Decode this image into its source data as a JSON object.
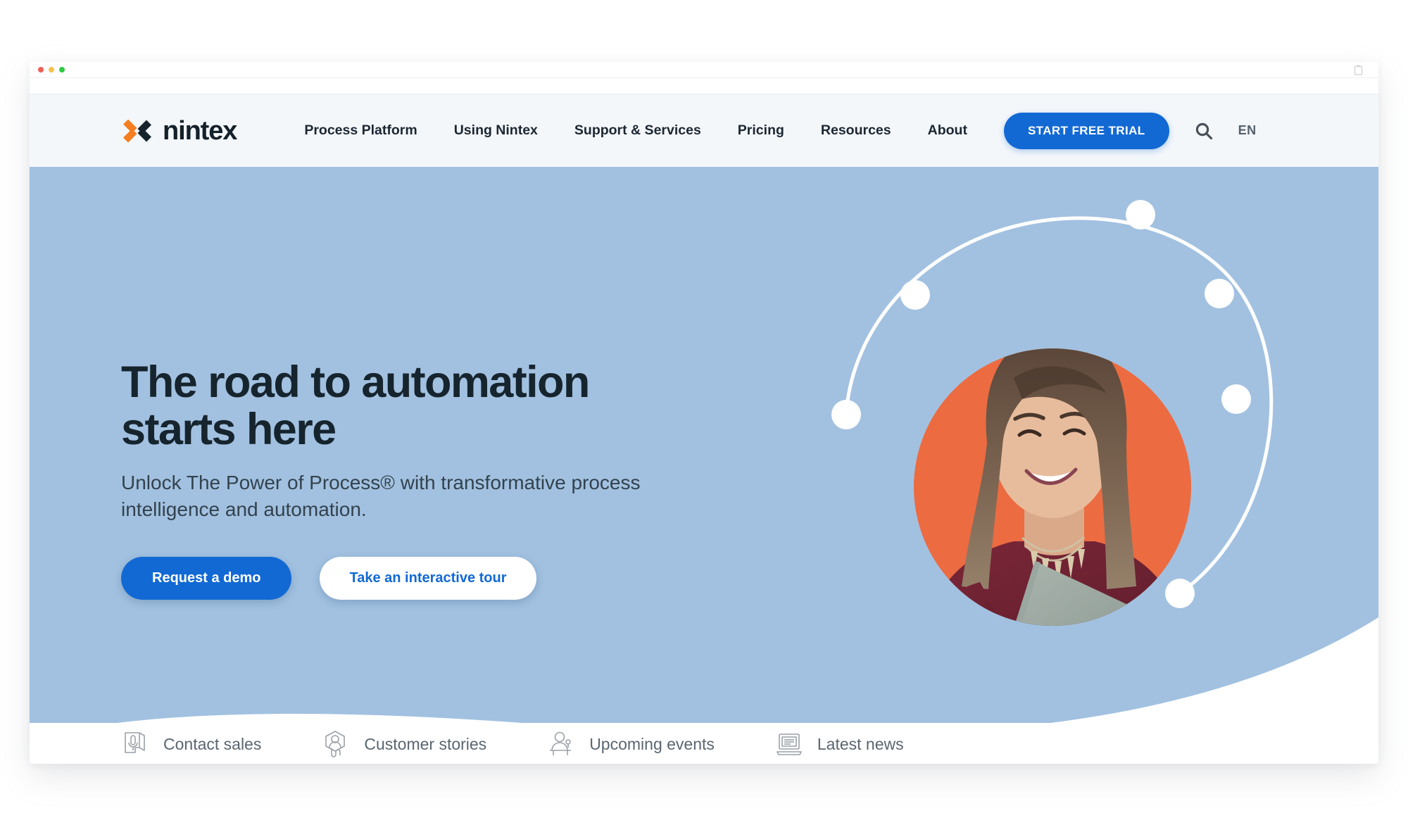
{
  "window": {
    "traffic_lights": [
      "close",
      "minimize",
      "maximize"
    ],
    "colors": {
      "close": "#ef5f56",
      "minimize": "#f6bf50",
      "maximize": "#2fca43"
    }
  },
  "brand": {
    "name": "nintex",
    "logo_icon": "nintex-x-logo",
    "orange": "#f57e20",
    "navy": "#16242e"
  },
  "nav": {
    "links": [
      {
        "label": "Process Platform"
      },
      {
        "label": "Using Nintex"
      },
      {
        "label": "Support & Services"
      },
      {
        "label": "Pricing"
      },
      {
        "label": "Resources"
      },
      {
        "label": "About"
      }
    ],
    "cta_label": "START FREE TRIAL",
    "search_icon": "search-icon",
    "language": "EN"
  },
  "hero": {
    "title_line1": "The road to automation",
    "title_line2": "starts here",
    "subtitle": "Unlock The Power of Process® with transformative process intelligence and automation.",
    "primary_cta": "Request a demo",
    "secondary_cta": "Take an interactive tour",
    "colors": {
      "background": "#a2c1e0",
      "accent_circle": "#ec6b41",
      "cta_blue": "#1269d3"
    },
    "image_alt": "Smiling woman holding a laptop"
  },
  "quicklinks": [
    {
      "label": "Contact sales",
      "icon": "contact-sales-icon"
    },
    {
      "label": "Customer stories",
      "icon": "customer-stories-icon"
    },
    {
      "label": "Upcoming events",
      "icon": "upcoming-events-icon"
    },
    {
      "label": "Latest news",
      "icon": "latest-news-icon"
    }
  ]
}
